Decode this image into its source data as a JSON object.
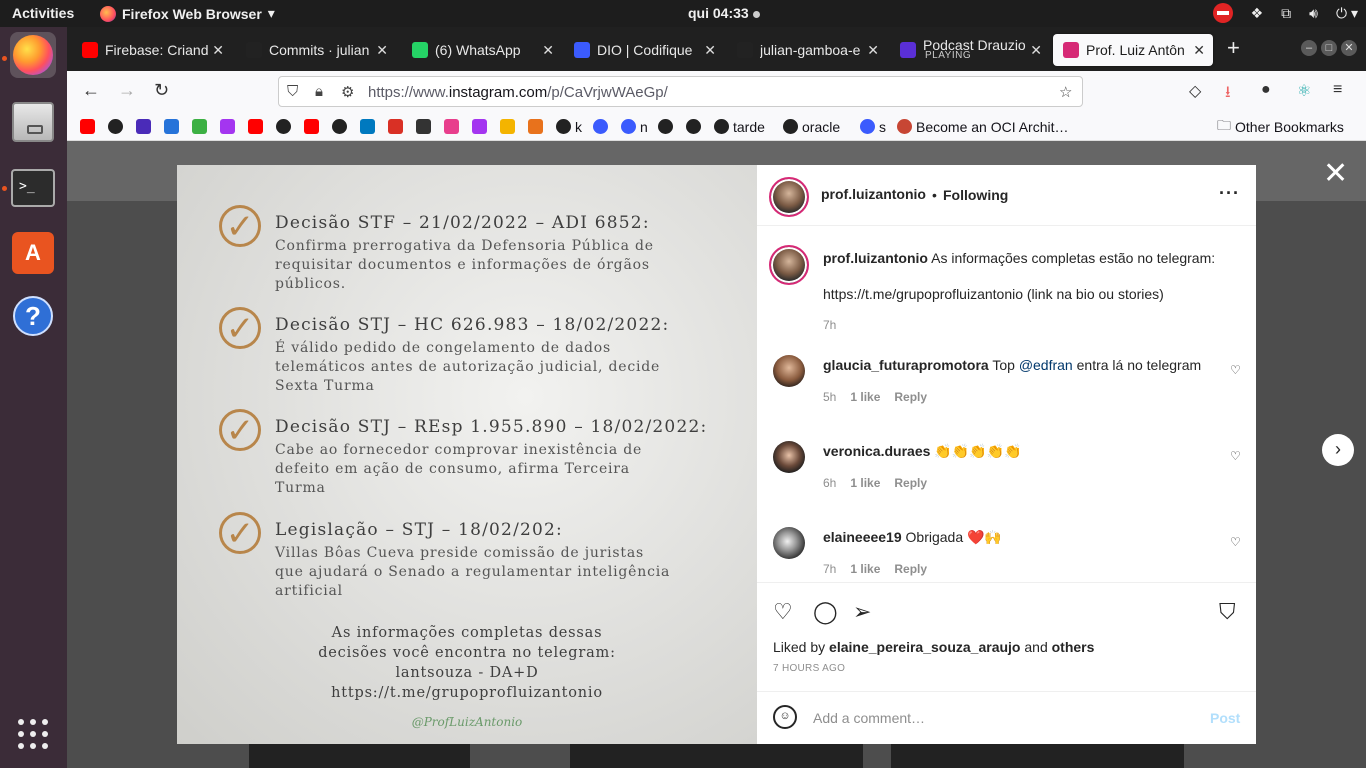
{
  "topbar": {
    "activities": "Activities",
    "app_name": "Firefox Web Browser",
    "clock": "qui 04:33"
  },
  "browser": {
    "tabs": [
      {
        "title": "Firebase: Criand",
        "icon": "youtube-icon",
        "color": "#ff0000"
      },
      {
        "title": "Commits · julian",
        "icon": "github-icon",
        "color": "#222222"
      },
      {
        "title": "(6) WhatsApp",
        "icon": "whatsapp-icon",
        "color": "#25d366"
      },
      {
        "title": "DIO | Codifique",
        "icon": "dio-icon",
        "color": "#3b5bfd"
      },
      {
        "title": "julian-gamboa-e",
        "icon": "github-icon",
        "color": "#222222"
      },
      {
        "title": "Podcast Drauzio",
        "subtitle": "PLAYING",
        "icon": "podcast-icon",
        "color": "#5a2fd6"
      },
      {
        "title": "Prof. Luiz Antôn",
        "icon": "instagram-icon",
        "color": "#d62976",
        "active": true
      }
    ],
    "url_prefix": "https://www.",
    "url_domain": "instagram.com",
    "url_path": "/p/CaVrjwWAeGp/",
    "bookmarks": [
      {
        "label": "",
        "icon": "youtube-icon",
        "color": "#ff0000"
      },
      {
        "label": "",
        "icon": "github-icon",
        "color": "#222222"
      },
      {
        "label": "",
        "icon": "bookmark-icon",
        "color": "#4a2bb8"
      },
      {
        "label": "",
        "icon": "play-icon",
        "color": "#2673d9"
      },
      {
        "label": "",
        "icon": "leaf-icon",
        "color": "#3cb043"
      },
      {
        "label": "",
        "icon": "udemy-icon",
        "color": "#a435f0"
      },
      {
        "label": "",
        "icon": "youtube-icon",
        "color": "#ff0000"
      },
      {
        "label": "",
        "icon": "github-icon",
        "color": "#222222"
      },
      {
        "label": "",
        "icon": "youtube-icon",
        "color": "#ff0000"
      },
      {
        "label": "",
        "icon": "github-icon",
        "color": "#222222"
      },
      {
        "label": "",
        "icon": "trello-icon",
        "color": "#0079bf"
      },
      {
        "label": "",
        "icon": "gmail-icon",
        "color": "#d93025"
      },
      {
        "label": "",
        "icon": "code-icon",
        "color": "#333333"
      },
      {
        "label": "",
        "icon": "swirl-icon",
        "color": "#e83e8c"
      },
      {
        "label": "",
        "icon": "udemy-icon",
        "color": "#a435f0"
      },
      {
        "label": "",
        "icon": "drive-icon",
        "color": "#f4b400"
      },
      {
        "label": "",
        "icon": "box-icon",
        "color": "#e8721c"
      },
      {
        "label": "k",
        "icon": "github-icon",
        "color": "#222222"
      },
      {
        "label": "",
        "icon": "dio-icon",
        "color": "#3b5bfd"
      },
      {
        "label": "n",
        "icon": "dio-icon",
        "color": "#3b5bfd"
      },
      {
        "label": "",
        "icon": "github-icon",
        "color": "#222222"
      },
      {
        "label": "",
        "icon": "github-icon",
        "color": "#222222"
      },
      {
        "label": "tarde",
        "icon": "github-icon",
        "color": "#222222"
      },
      {
        "label": "oracle",
        "icon": "github-icon",
        "color": "#222222"
      },
      {
        "label": "s",
        "icon": "dio-icon",
        "color": "#3b5bfd"
      },
      {
        "label": "Become an OCI Archit…",
        "icon": "oracle-icon",
        "color": "#c74634"
      }
    ],
    "other_bookmarks": "Other Bookmarks"
  },
  "post_image": {
    "decisions": [
      {
        "title": "Decisão STF – 21/02/2022 – ADI 6852:",
        "body": "Confirma prerrogativa da Defensoria Pública de requisitar documentos e informações de órgãos públicos."
      },
      {
        "title": "Decisão STJ – HC 626.983 – 18/02/2022:",
        "body": "É válido pedido de congelamento de dados telemáticos antes de autorização judicial, decide Sexta Turma"
      },
      {
        "title": "Decisão STJ – REsp 1.955.890 – 18/02/2022:",
        "body": "Cabe ao fornecedor comprovar inexistência de defeito em ação de consumo, afirma Terceira Turma"
      },
      {
        "title": "Legislação – STJ – 18/02/202:",
        "body": "Villas Bôas Cueva preside comissão de juristas que ajudará o Senado a regulamentar inteligência artificial"
      }
    ],
    "closing_lines": [
      "As informações completas dessas",
      "decisões você encontra no telegram:",
      "lantsouza - DA+D",
      "https://t.me/grupoprofluizantonio"
    ],
    "signature": "@ProfLuizAntonio"
  },
  "post_panel": {
    "username": "prof.luizantonio",
    "following": "Following",
    "caption": {
      "user": "prof.luizantonio",
      "text": "As informações completas estão no telegram:",
      "link_line": "https://t.me/grupoprofluizantonio (link na bio ou stories)",
      "time": "7h"
    },
    "comments": [
      {
        "user": "glaucia_futurapromotora",
        "pre": "Top ",
        "mention": "@edfran",
        "post": " entra lá no telegram",
        "time": "5h",
        "likes": "1 like",
        "reply": "Reply"
      },
      {
        "user": "veronica.duraes",
        "pre": "👏👏👏👏👏",
        "mention": "",
        "post": "",
        "time": "6h",
        "likes": "1 like",
        "reply": "Reply"
      },
      {
        "user": "elaineeee19",
        "pre": "Obrigada ❤️🙌",
        "mention": "",
        "post": "",
        "time": "7h",
        "likes": "1 like",
        "reply": "Reply"
      }
    ],
    "liked_by_prefix": "Liked by",
    "liked_by_user": "elaine_pereira_souza_araujo",
    "liked_by_and": "and",
    "liked_by_others": "others",
    "time_ago": "7 HOURS AGO",
    "comment_placeholder": "Add a comment…",
    "post_button": "Post"
  }
}
